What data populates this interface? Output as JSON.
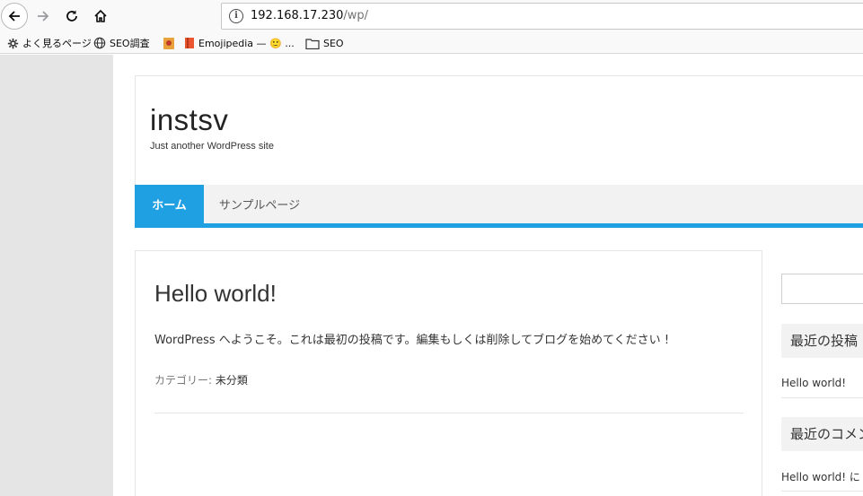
{
  "browser": {
    "url_host": "192.168.17.230",
    "url_path": "/wp/",
    "bookmarks": [
      {
        "label": "よく見るページ",
        "icon": "gear-icon"
      },
      {
        "label": "SEO調査",
        "icon": "globe-icon"
      },
      {
        "label": "",
        "icon": "bookmark-favicon-icon"
      },
      {
        "label": "Emojipedia — 🙂 ...",
        "icon": "emojipedia-favicon-icon"
      },
      {
        "label": "SEO",
        "icon": "folder-icon"
      }
    ]
  },
  "site": {
    "title": "instsv",
    "tagline": "Just another WordPress site",
    "accent_color": "#1fa0e3"
  },
  "nav": {
    "items": [
      {
        "label": "ホーム",
        "active": true
      },
      {
        "label": "サンプルページ",
        "active": false
      }
    ]
  },
  "post": {
    "title": "Hello world!",
    "body": "WordPress へようこそ。これは最初の投稿です。編集もしくは削除してブログを始めてください !",
    "category_label": "カテゴリー:",
    "category_value": "未分類"
  },
  "sidebar": {
    "recent_posts_title": "最近の投稿",
    "recent_posts": [
      "Hello world!"
    ],
    "recent_comments_title": "最近のコメント",
    "recent_comments": [
      "Hello world! に WordPress コメントの投稿者 より"
    ]
  }
}
